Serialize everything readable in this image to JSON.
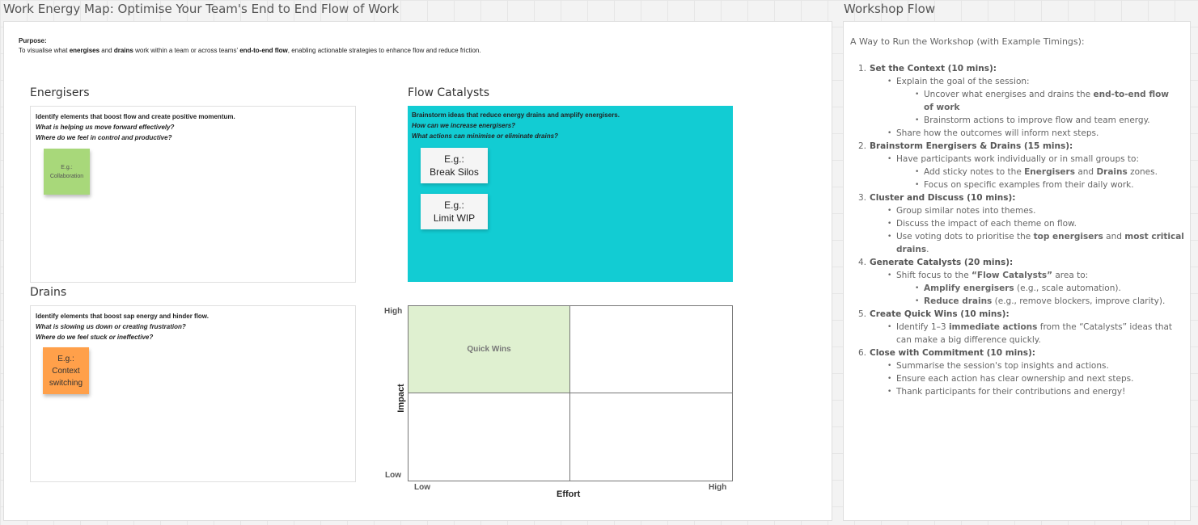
{
  "main_frame": {
    "title": "Work Energy Map: Optimise Your Team's End to End Flow of Work",
    "purpose_label": "Purpose:",
    "purpose": [
      {
        "t": "To visualise what ",
        "b": false
      },
      {
        "t": "energises",
        "b": true
      },
      {
        "t": " and ",
        "b": false
      },
      {
        "t": "drains",
        "b": true
      },
      {
        "t": " work within a team or across teams' ",
        "b": false
      },
      {
        "t": "end-to-end flow",
        "b": true
      },
      {
        "t": ", enabling actionable strategies to enhance flow and reduce friction.",
        "b": false
      }
    ],
    "energisers": {
      "title": "Energisers",
      "heading": "Identify elements that boost flow and create positive momentum.",
      "q1": "What is helping us move forward effectively?",
      "q2": "Where do we feel in control and productive?",
      "sticky": "E.g.:\nCollaboration",
      "sticky_color": "#a8d87a"
    },
    "drains": {
      "title": "Drains",
      "heading": "Identify elements that boost sap energy and hinder flow.",
      "q1": "What is slowing us down or creating frustration?",
      "q2": "Where do we feel stuck or ineffective?",
      "sticky": "E.g.:\nContext\nswitching",
      "sticky_color": "#ffa04a"
    },
    "catalysts": {
      "title": "Flow Catalysts",
      "heading": "Brainstorm ideas that reduce energy drains and amplify energisers.",
      "q1": "How can we increase energisers?",
      "q2": "What actions can minimise or eliminate drains?",
      "card1": "E.g.:\nBreak Silos",
      "card2": "E.g.:\nLimit WIP",
      "bg_color": "#12ccd3"
    },
    "matrix": {
      "quick_wins": "Quick Wins",
      "quick_wins_color": "#dff0d0",
      "y_label": "Impact",
      "y_high": "High",
      "y_low": "Low",
      "x_label": "Effort",
      "x_low": "Low",
      "x_high": "High"
    }
  },
  "flow_frame": {
    "title": "Workshop Flow",
    "heading": "A Way to Run the Workshop (with Example Timings):",
    "steps": [
      {
        "num": "1.",
        "title": "Set the Context (10 mins):",
        "items": [
          {
            "lvl": 1,
            "parts": [
              {
                "t": "Explain the goal of the session:",
                "b": false
              }
            ]
          },
          {
            "lvl": 2,
            "parts": [
              {
                "t": "Uncover what energises and drains the ",
                "b": false
              },
              {
                "t": "end-to-end flow of work",
                "b": true
              }
            ]
          },
          {
            "lvl": 2,
            "parts": [
              {
                "t": "Brainstorm actions to improve flow and team energy.",
                "b": false
              }
            ]
          },
          {
            "lvl": 1,
            "parts": [
              {
                "t": "Share how the outcomes will inform next steps.",
                "b": false
              }
            ]
          }
        ]
      },
      {
        "num": "2.",
        "title": "Brainstorm Energisers & Drains (15 mins):",
        "items": [
          {
            "lvl": 1,
            "parts": [
              {
                "t": "Have participants work individually or in small groups to:",
                "b": false
              }
            ]
          },
          {
            "lvl": 2,
            "parts": [
              {
                "t": "Add sticky notes to the ",
                "b": false
              },
              {
                "t": "Energisers",
                "b": true
              },
              {
                "t": " and ",
                "b": false
              },
              {
                "t": "Drains",
                "b": true
              },
              {
                "t": " zones.",
                "b": false
              }
            ]
          },
          {
            "lvl": 2,
            "parts": [
              {
                "t": "Focus on specific examples from their daily work.",
                "b": false
              }
            ]
          }
        ]
      },
      {
        "num": "3.",
        "title": "Cluster and Discuss (10 mins):",
        "items": [
          {
            "lvl": 1,
            "parts": [
              {
                "t": "Group similar notes into themes.",
                "b": false
              }
            ]
          },
          {
            "lvl": 1,
            "parts": [
              {
                "t": "Discuss the impact of each theme on flow.",
                "b": false
              }
            ]
          },
          {
            "lvl": 1,
            "parts": [
              {
                "t": "Use voting dots to prioritise the ",
                "b": false
              },
              {
                "t": "top energisers",
                "b": true
              },
              {
                "t": " and ",
                "b": false
              },
              {
                "t": "most critical drains",
                "b": true
              },
              {
                "t": ".",
                "b": false
              }
            ]
          }
        ]
      },
      {
        "num": "4.",
        "title": "Generate Catalysts (20 mins):",
        "items": [
          {
            "lvl": 1,
            "parts": [
              {
                "t": "Shift focus to the ",
                "b": false
              },
              {
                "t": "“Flow Catalysts”",
                "b": true
              },
              {
                "t": " area to:",
                "b": false
              }
            ]
          },
          {
            "lvl": 2,
            "parts": [
              {
                "t": "Amplify energisers",
                "b": true
              },
              {
                "t": " (e.g., scale automation).",
                "b": false
              }
            ]
          },
          {
            "lvl": 2,
            "parts": [
              {
                "t": "Reduce drains",
                "b": true
              },
              {
                "t": " (e.g., remove blockers, improve clarity).",
                "b": false
              }
            ]
          }
        ]
      },
      {
        "num": "5.",
        "title": "Create Quick Wins (10 mins):",
        "items": [
          {
            "lvl": 1,
            "parts": [
              {
                "t": "Identify 1–3 ",
                "b": false
              },
              {
                "t": "immediate actions",
                "b": true
              },
              {
                "t": " from the “Catalysts” ideas that can make a big difference quickly.",
                "b": false
              }
            ]
          }
        ]
      },
      {
        "num": "6.",
        "title": "Close with Commitment (10 mins):",
        "items": [
          {
            "lvl": 1,
            "parts": [
              {
                "t": "Summarise the session's top insights and actions.",
                "b": false
              }
            ]
          },
          {
            "lvl": 1,
            "parts": [
              {
                "t": "Ensure each action has clear ownership and next steps.",
                "b": false
              }
            ]
          },
          {
            "lvl": 1,
            "parts": [
              {
                "t": "Thank participants for their contributions and energy!",
                "b": false
              }
            ]
          }
        ]
      }
    ]
  }
}
